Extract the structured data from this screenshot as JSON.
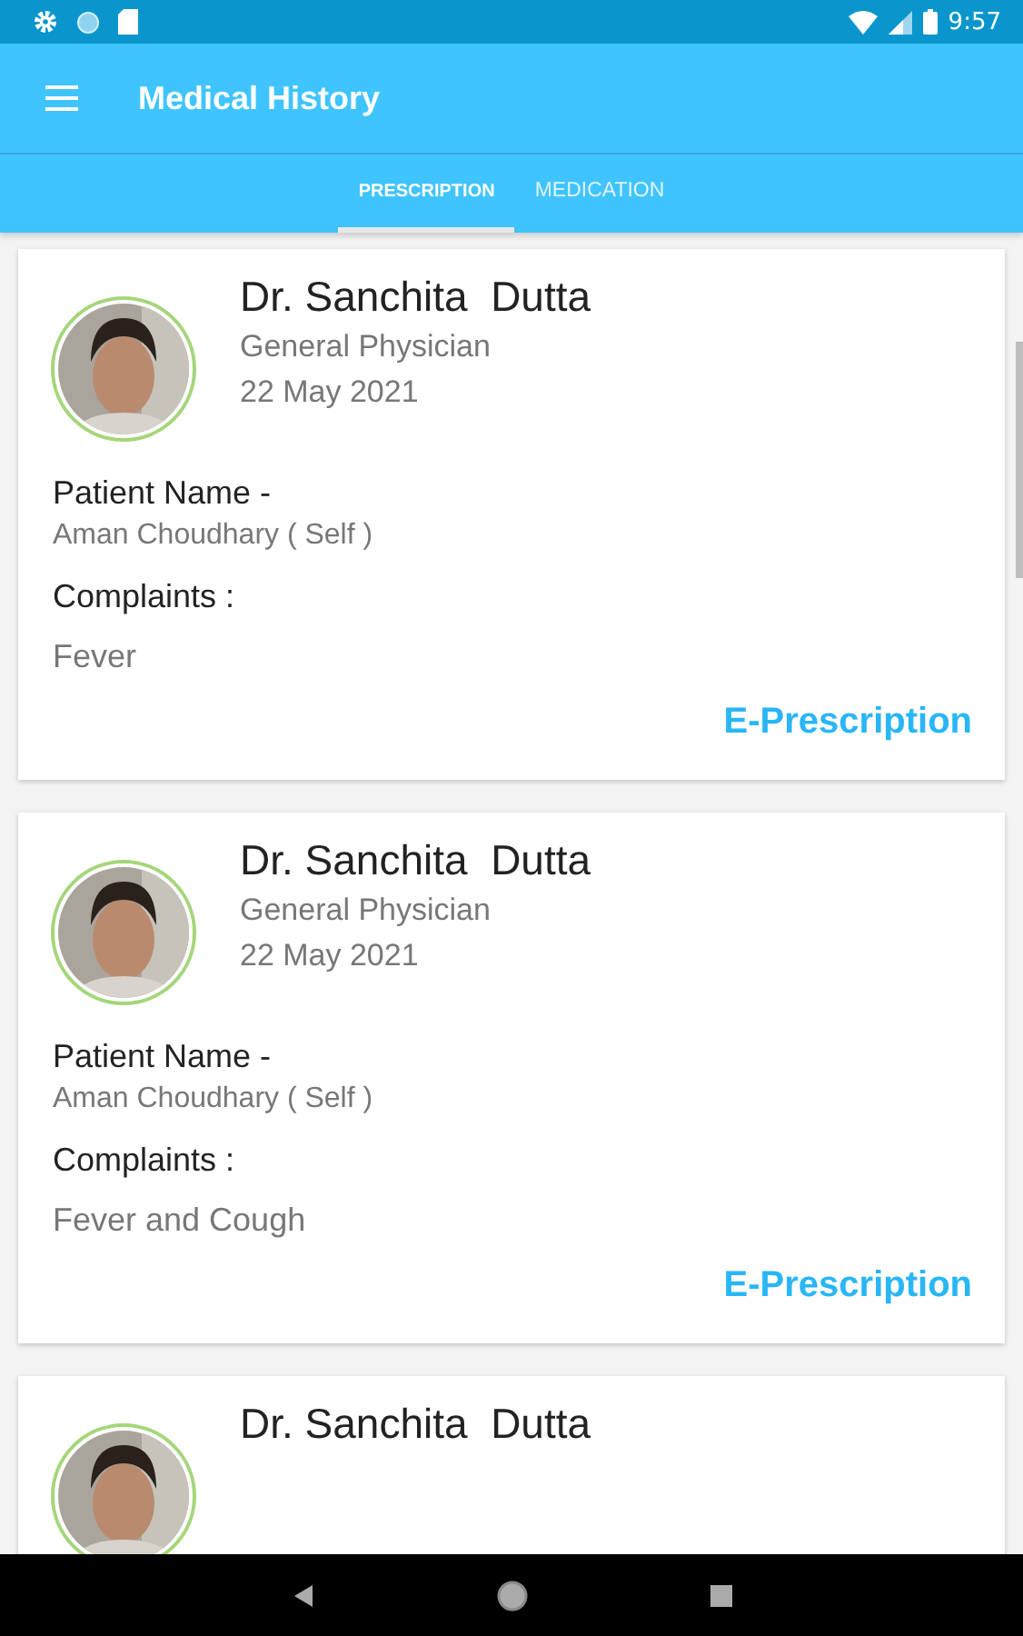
{
  "status_bar": {
    "time": "9:57"
  },
  "app_bar": {
    "title": "Medical History"
  },
  "tabs": [
    {
      "label": "PRESCRIPTION",
      "selected": true
    },
    {
      "label": "MEDICATION",
      "selected": false
    }
  ],
  "records": [
    {
      "doctor": "Dr. Sanchita  Dutta",
      "specialty": "General Physician",
      "date": "22 May 2021",
      "patient_label": "Patient Name -",
      "patient": "Aman Choudhary ( Self )",
      "complaints_label": "Complaints :",
      "complaints": "Fever",
      "action": "E-Prescription"
    },
    {
      "doctor": "Dr. Sanchita  Dutta",
      "specialty": "General Physician",
      "date": "22 May 2021",
      "patient_label": "Patient Name -",
      "patient": "Aman Choudhary ( Self )",
      "complaints_label": "Complaints :",
      "complaints": "Fever and Cough",
      "action": "E-Prescription"
    },
    {
      "doctor": "Dr. Sanchita  Dutta"
    }
  ]
}
